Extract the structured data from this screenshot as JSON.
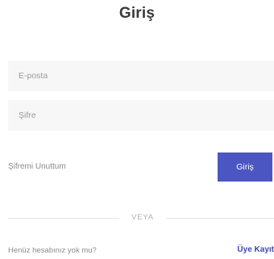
{
  "form": {
    "title": "Giriş",
    "email": {
      "placeholder": "E-posta",
      "value": ""
    },
    "password": {
      "placeholder": "Şifre",
      "value": ""
    },
    "forgot_password": "Şifremi Unuttum",
    "submit_label": "Giriş"
  },
  "divider": {
    "label": "VEYA"
  },
  "signup": {
    "prompt": "Henüz hesabınız yok mu?",
    "link_label": "Üye Kayıt"
  },
  "colors": {
    "accent": "#4c56c2",
    "link": "#3d46b5",
    "field_background": "#f7f7f8"
  }
}
